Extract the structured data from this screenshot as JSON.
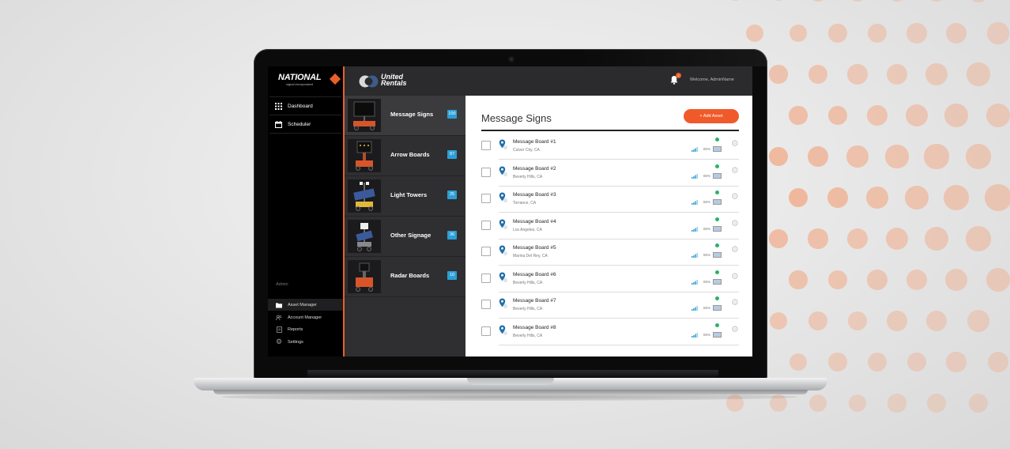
{
  "sidebar": {
    "brand": {
      "name": "NATIONAL",
      "tagline": "signal incorporated"
    },
    "nav": [
      {
        "label": "Dashboard",
        "icon": "grid-icon"
      },
      {
        "label": "Scheduler",
        "icon": "calendar-icon"
      }
    ],
    "section_label": "Admin",
    "admin_items": [
      {
        "label": "Asset Manager",
        "icon": "folder-icon",
        "active": true
      },
      {
        "label": "Account Manager",
        "icon": "users-icon",
        "active": false
      },
      {
        "label": "Reports",
        "icon": "document-icon",
        "active": false
      },
      {
        "label": "Settings",
        "icon": "gear-icon",
        "active": false
      }
    ]
  },
  "topbar": {
    "logo": {
      "line1": "United",
      "line2": "Rentals"
    },
    "notification_count": "2",
    "welcome": "Welcome, AdminName"
  },
  "categories": [
    {
      "label": "Message Signs",
      "count": "100",
      "active": true
    },
    {
      "label": "Arrow Boards",
      "count": "87",
      "active": false
    },
    {
      "label": "Light Towers",
      "count": "25",
      "active": false
    },
    {
      "label": "Other Signage",
      "count": "36",
      "active": false
    },
    {
      "label": "Radar Boards",
      "count": "10",
      "active": false
    }
  ],
  "main": {
    "title": "Message Signs",
    "add_button": "+ Add Asset",
    "assets": [
      {
        "name": "Message Board #1",
        "location": "Culver City, CA",
        "battery": "85%"
      },
      {
        "name": "Message Board #2",
        "location": "Beverly Hills, CA",
        "battery": "85%"
      },
      {
        "name": "Message Board #3",
        "location": "Torrance, CA",
        "battery": "85%"
      },
      {
        "name": "Message Board #4",
        "location": "Los Angeles, CA",
        "battery": "85%"
      },
      {
        "name": "Message Board #5",
        "location": "Marina Del Rey, CA",
        "battery": "85%"
      },
      {
        "name": "Message Board #6",
        "location": "Beverly Hills, CA",
        "battery": "85%"
      },
      {
        "name": "Message Board #7",
        "location": "Beverly Hills, CA",
        "battery": "85%"
      },
      {
        "name": "Message Board #8",
        "location": "Beverly Hills, CA",
        "battery": "85%"
      }
    ]
  },
  "colors": {
    "accent": "#f05a2a",
    "badge": "#2c9fd6",
    "status_online": "#27b36a",
    "sidebar_bg": "#000000",
    "topbar_bg": "#2b2b2d"
  }
}
